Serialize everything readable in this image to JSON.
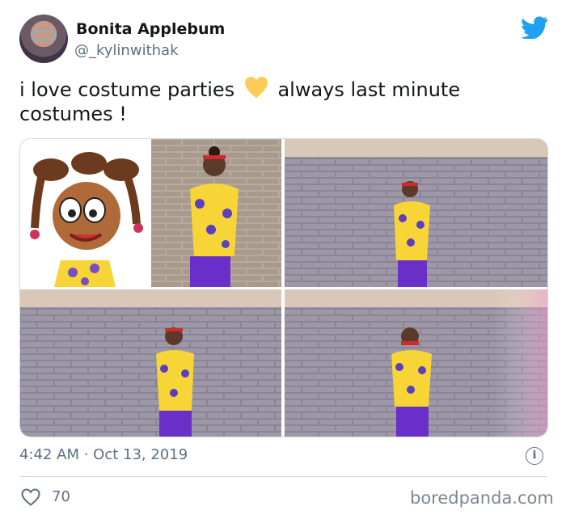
{
  "author": {
    "name": "Bonita Applebum",
    "handle": "@_kylinwithak"
  },
  "tweet": {
    "text_before": "i love costume parties",
    "text_after": "always last minute costumes !",
    "emoji": "yellow-heart"
  },
  "meta": {
    "timestamp": "4:42 AM · Oct 13, 2019",
    "likes": "70"
  },
  "watermark": "boredpanda.com",
  "colors": {
    "twitter_blue": "#1da1f2",
    "text_secondary": "#5b7083",
    "shirt_yellow": "#f7d536",
    "spot_purple": "#5a3fc0"
  },
  "icons": [
    "twitter-bird-icon",
    "info-icon",
    "heart-outline-icon"
  ]
}
